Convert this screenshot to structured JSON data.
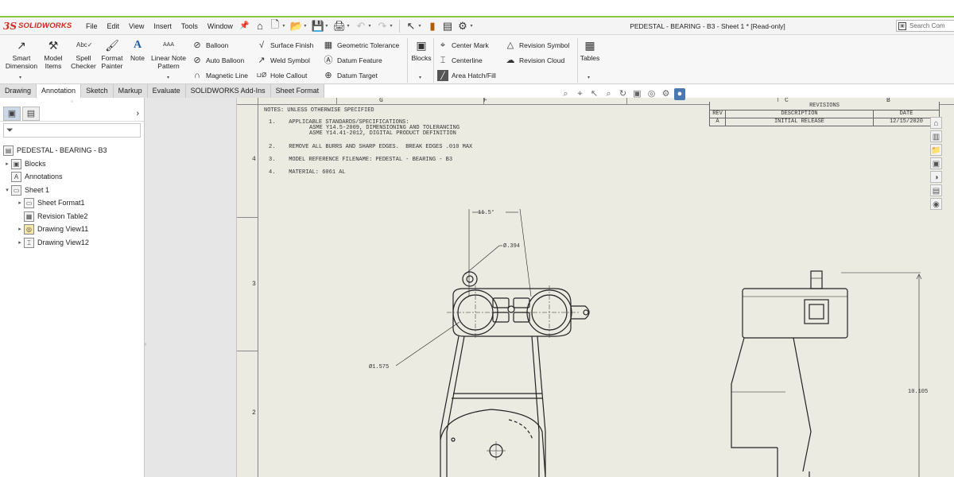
{
  "app": {
    "logo_mark": "3S",
    "logo_text": "SOLIDWORKS",
    "doc_title": "PEDESTAL - BEARING - B3 - Sheet 1 * [Read-only]",
    "search_placeholder": "Search Com"
  },
  "menu": [
    "File",
    "Edit",
    "View",
    "Insert",
    "Tools",
    "Window"
  ],
  "ribbon": {
    "smart_dimension": [
      "Smart",
      "Dimension"
    ],
    "model_items": [
      "Model",
      "Items"
    ],
    "spell_checker": [
      "Spell",
      "Checker"
    ],
    "format_painter": [
      "Format",
      "Painter"
    ],
    "note": "Note",
    "linear_note_pattern": [
      "Linear Note",
      "Pattern"
    ],
    "balloon": "Balloon",
    "auto_balloon": "Auto Balloon",
    "magnetic_line": "Magnetic Line",
    "surface_finish": "Surface Finish",
    "weld_symbol": "Weld Symbol",
    "hole_callout": "Hole Callout",
    "geometric_tolerance": "Geometric Tolerance",
    "datum_feature": "Datum Feature",
    "datum_target": "Datum Target",
    "blocks": "Blocks",
    "center_mark": "Center Mark",
    "centerline": "Centerline",
    "area_hatch_fill": "Area Hatch/Fill",
    "revision_symbol": "Revision Symbol",
    "revision_cloud": "Revision Cloud",
    "tables": "Tables"
  },
  "tabs": [
    {
      "label": "Drawing",
      "active": false
    },
    {
      "label": "Annotation",
      "active": true
    },
    {
      "label": "Sketch",
      "active": false
    },
    {
      "label": "Markup",
      "active": false
    },
    {
      "label": "Evaluate",
      "active": false
    },
    {
      "label": "SOLIDWORKS Add-Ins",
      "active": false
    },
    {
      "label": "Sheet Format",
      "active": false
    }
  ],
  "tree": {
    "root": "PEDESTAL - BEARING - B3",
    "items": [
      {
        "label": "Blocks"
      },
      {
        "label": "Annotations"
      },
      {
        "label": "Sheet 1"
      },
      {
        "label": "Sheet Format1"
      },
      {
        "label": "Revision Table2"
      },
      {
        "label": "Drawing View11"
      },
      {
        "label": "Drawing View12"
      }
    ]
  },
  "sheet": {
    "zones_top": [
      "G",
      "F",
      "C",
      "B"
    ],
    "zones_left": [
      "4",
      "3",
      "2"
    ],
    "notes": [
      "NOTES: UNLESS OTHERWISE SPECIFIED",
      "1.    APPLICABLE STANDARDS/SPECIFICATIONS:",
      "ASME Y14.5-2009, DIMENSIONING AND TOLERANCING",
      "ASME Y14.41-2012, DIGITAL PRODUCT DEFINITION",
      "2.    REMOVE ALL BURRS AND SHARP EDGES.  BREAK EDGES .010 MAX",
      "3.    MODEL REFERENCE FILENAME: PEDESTAL - BEARING - B3",
      "4.    MATERIAL: 6061 AL"
    ],
    "revisions": {
      "title": "REVISIONS",
      "headers": [
        "REV",
        "DESCRIPTION",
        "DATE"
      ],
      "rows": [
        [
          "A",
          "INITIAL RELEASE",
          "12/15/2020"
        ]
      ]
    },
    "dimensions": {
      "angle": "11.5°",
      "small_dia": "Ø.394",
      "large_dia": "Ø1.575",
      "height": "10.105"
    }
  },
  "colors": {
    "accent_green": "#8dc63f",
    "brand_red": "#d52b1e",
    "sheet_bg": "#ecebe2"
  }
}
